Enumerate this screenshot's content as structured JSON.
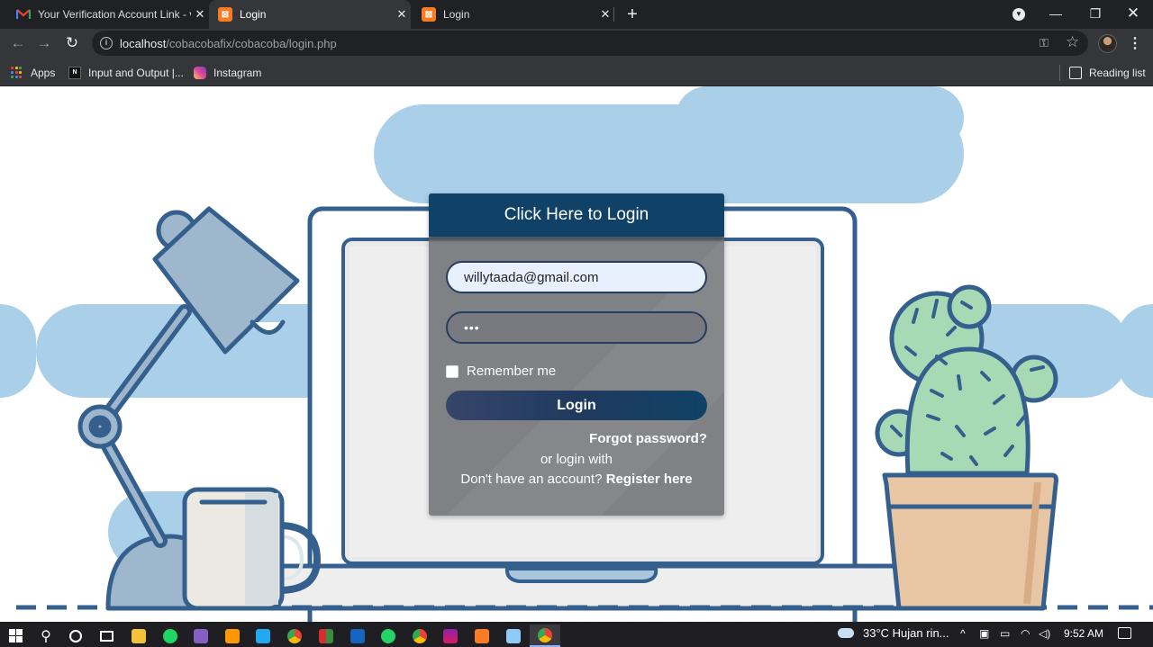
{
  "browser": {
    "tabs": [
      {
        "title": "Your Verification Account Link - v",
        "favicon": "gmail-icon",
        "active": false
      },
      {
        "title": "Login",
        "favicon": "xampp-icon",
        "active": true
      },
      {
        "title": "Login",
        "favicon": "xampp-icon",
        "active": false
      }
    ],
    "url_host": "localhost",
    "url_path": "/cobacobafix/cobacoba/login.php",
    "bookmarks": [
      {
        "label": "Apps",
        "icon": "apps-grid-icon"
      },
      {
        "label": "Input and Output |...",
        "icon": "n-logo-icon"
      },
      {
        "label": "Instagram",
        "icon": "instagram-icon"
      }
    ],
    "reading_list": "Reading list"
  },
  "login": {
    "header": "Click Here to Login",
    "email_value": "willytaada@gmail.com",
    "password_value": "•••",
    "remember_label": "Remember me",
    "remember_checked": false,
    "button_label": "Login",
    "forgot_label": "Forgot password?",
    "or_login_with": "or login with",
    "no_account_text": "Don't have an account?",
    "register_label": "Register here"
  },
  "taskbar": {
    "apps": [
      "windows-start-icon",
      "search-icon",
      "cortana-icon",
      "task-view-icon",
      "file-explorer-icon",
      "spotify-icon",
      "visual-studio-icon",
      "sublime-text-icon",
      "vscode-icon",
      "chrome-icon",
      "winrar-icon",
      "filezilla-icon",
      "whatsapp-icon",
      "chrome-profile-icon",
      "winrar-archive-icon",
      "xampp-icon",
      "notepad-icon",
      "chrome-active-icon"
    ],
    "weather": "33°C  Hujan rin...",
    "clock": "9:52 AM"
  },
  "colors": {
    "header_bg": "#0f4266",
    "card_bg": "#707276",
    "sky_blue": "#a9cfe9",
    "outline": "#35608e"
  }
}
